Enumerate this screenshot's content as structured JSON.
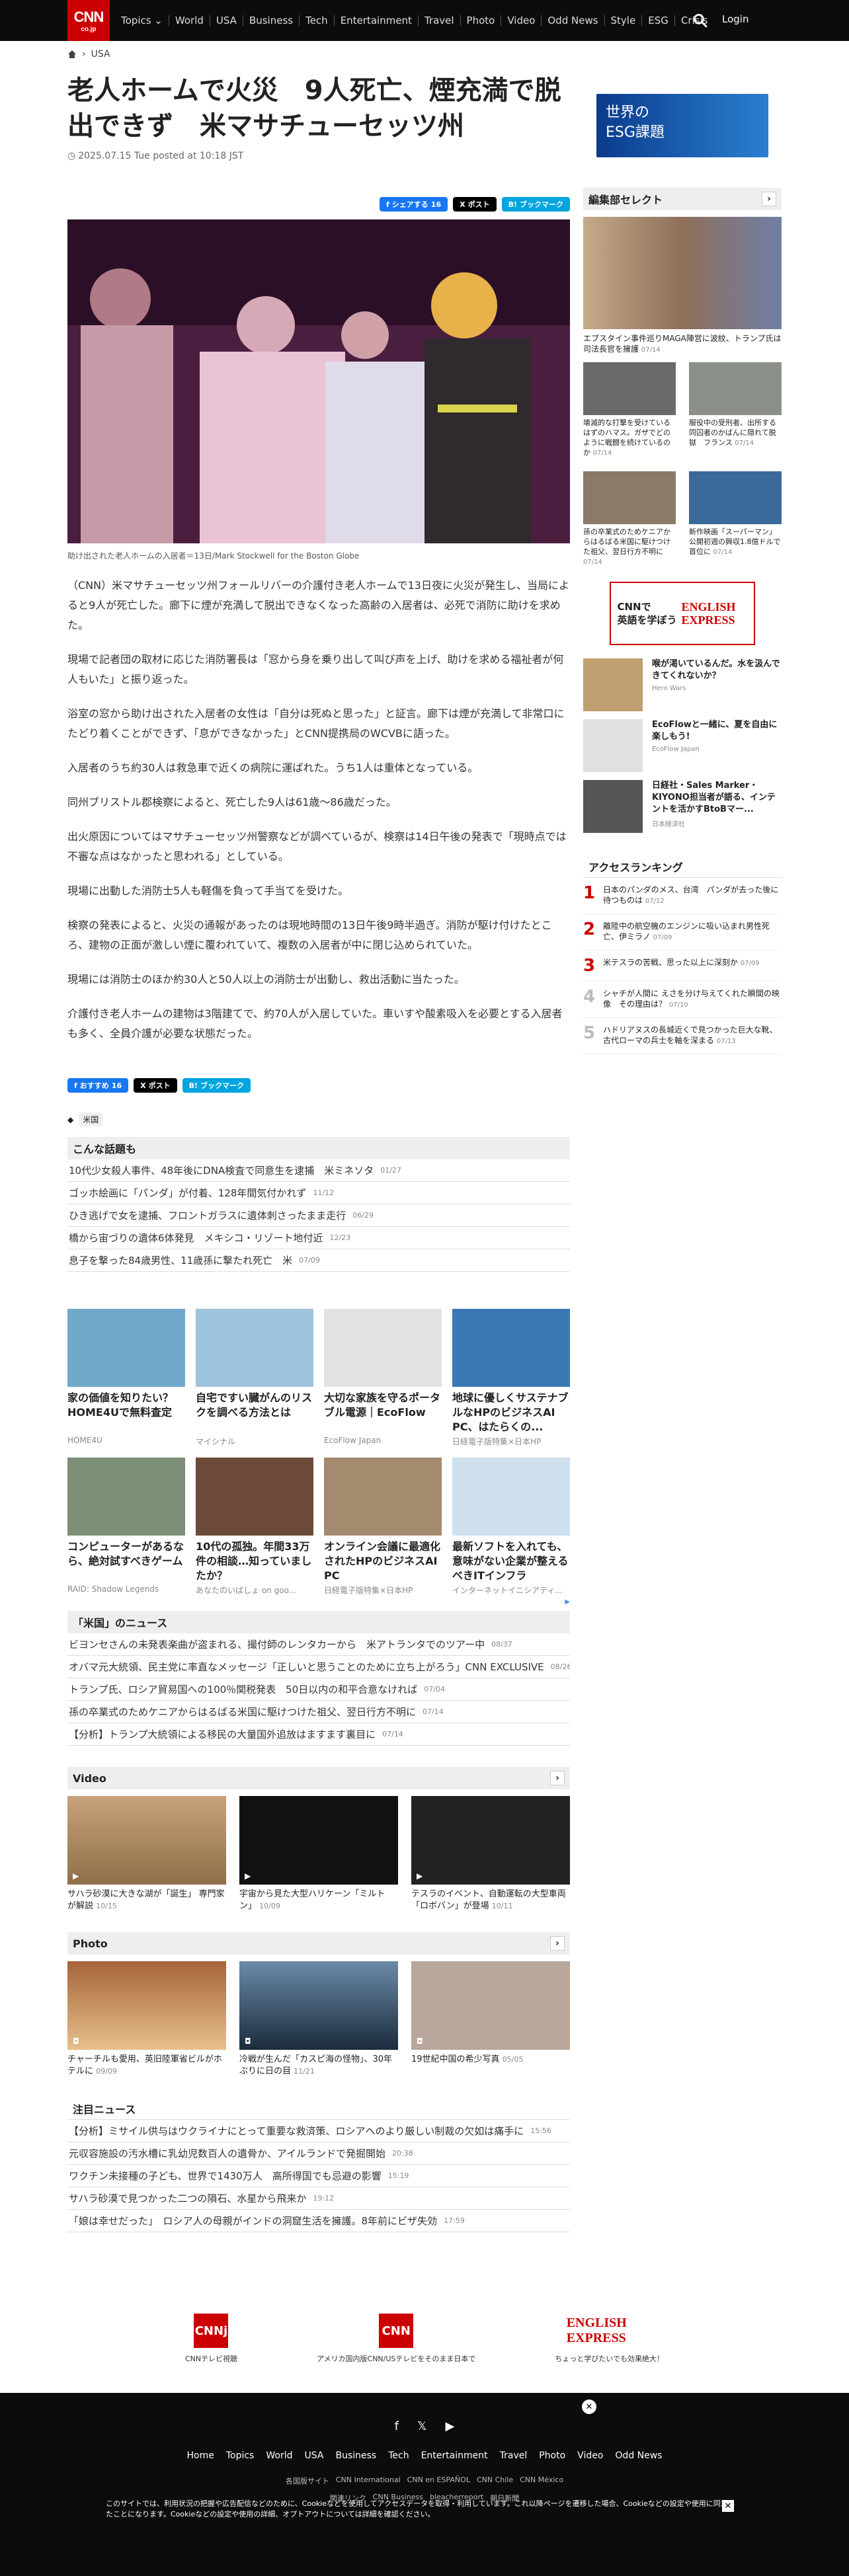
{
  "header": {
    "logo": "CNN",
    "logo_sub": "co.jp",
    "login": "Login",
    "nav": [
      "Topics",
      "World",
      "USA",
      "Business",
      "Tech",
      "Entertainment",
      "Travel",
      "Photo",
      "Video",
      "Odd News",
      "Style",
      "ESG",
      "Crisis"
    ]
  },
  "breadcrumb": {
    "home_icon": "home-icon",
    "section": "USA"
  },
  "article": {
    "title": "老人ホームで火災　9人死亡、煙充満で脱出できず　米マサチューセッツ州",
    "date": "2025.07.15 Tue posted at 10:18 JST",
    "share": {
      "fb": "シェアする",
      "fb_count": "16",
      "x": "ポスト",
      "hb": "ブックマーク",
      "fb2": "おすすめ",
      "fb2_count": "16"
    },
    "caption": "助け出された老人ホームの入居者＝13日/Mark Stockwell for the Boston Globe",
    "paragraphs": [
      "（CNN）米マサチューセッツ州フォールリバーの介護付き老人ホームで13日夜に火災が発生し、当局によると9人が死亡した。廊下に煙が充満して脱出できなくなった高齢の入居者は、必死で消防に助けを求めた。",
      "現場で記者団の取材に応じた消防署長は「窓から身を乗り出して叫び声を上げ、助けを求める福祉者が何人もいた」と振り返った。",
      "浴室の窓から助け出された入居者の女性は「自分は死ぬと思った」と証言。廊下は煙が充満して非常口にたどり着くことができず、「息ができなかった」とCNN提携局のWCVBに語った。",
      "入居者のうち約30人は救急車で近くの病院に運ばれた。うち1人は重体となっている。",
      "同州ブリストル郡検察によると、死亡した9人は61歳～86歳だった。",
      "出火原因についてはマサチューセッツ州警察などが調べているが、検察は14日午後の発表で「現時点では不審な点はなかったと思われる」としている。",
      "現場に出動した消防士5人も軽傷を負って手当てを受けた。",
      "検察の発表によると、火災の通報があったのは現地時間の13日午後9時半過ぎ。消防が駆け付けたところ、建物の正面が激しい煙に覆われていて、複数の入居者が中に閉じ込められていた。",
      "現場には消防士のほか約30人と50人以上の消防士が出動し、救出活動に当たった。",
      "介護付き老人ホームの建物は3階建てで、約70人が入居していた。車いすや酸素吸入を必要とする入居者も多く、全員介護が必要な状態だった。"
    ],
    "tag": "米国"
  },
  "related": {
    "title": "こんな話題も",
    "items": [
      {
        "t": "10代少女殺人事件、48年後にDNA検査で同意生を逮捕　米ミネソタ",
        "d": "01/27"
      },
      {
        "t": "ゴッホ絵画に「パンダ」が付着、128年間気付かれず",
        "d": "11/12"
      },
      {
        "t": "ひき逃げで女を逮捕、フロントガラスに遺体刺さったまま走行",
        "d": "06/29"
      },
      {
        "t": "橋から宙づりの遺体6体発見　メキシコ・リゾート地付近",
        "d": "12/23"
      },
      {
        "t": "息子を撃った84歳男性、11歳孫に撃たれ死亡　米",
        "d": "07/09"
      }
    ]
  },
  "promo": [
    {
      "t": "家の価値を知りたい？ HOME4Uで無料査定",
      "s": "HOME4U"
    },
    {
      "t": "自宅ですい臓がんのリスクを調べる方法とは",
      "s": "マイシナル"
    },
    {
      "t": "大切な家族を守るポータブル電源｜EcoFlow",
      "s": "EcoFlow Japan"
    },
    {
      "t": "地球に優しくサステナブルなHPのビジネスAI PC、はたらくの...",
      "s": "日経電子版特集×日本HP"
    },
    {
      "t": "コンピューターがあるなら、絶対試すべきゲーム",
      "s": "RAID: Shadow Legends"
    },
    {
      "t": "10代の孤独。年間33万件の相談…知っていましたか？",
      "s": "あなたのいばしょ on goo..."
    },
    {
      "t": "オンライン会議に最適化されたHPのビジネスAI PC",
      "s": "日経電子版特集×日本HP"
    },
    {
      "t": "最新ソフトを入れても、意味がない企業が整えるべきITインフラ",
      "s": "インターネットイニシアティ..."
    }
  ],
  "usnews": {
    "title": "「米国」のニュース",
    "items": [
      {
        "t": "ビヨンセさんの未発表楽曲が盗まれる、撮付師のレンタカーから　米アトランタでのツアー中",
        "d": "08/37"
      },
      {
        "t": "オバマ元大統領、民主党に率直なメッセージ「正しいと思うことのために立ち上がろう」CNN EXCLUSIVE",
        "d": "08/26"
      },
      {
        "t": "トランプ氏、ロシア貿易国への100％関税発表　50日以内の和平合意なければ",
        "d": "07/04"
      },
      {
        "t": "孫の卒業式のためケニアからはるばる米国に駆けつけた祖父、翌日行方不明に",
        "d": "07/14"
      },
      {
        "t": "【分析】トランプ大統領による移民の大量国外追放はますます裏目に",
        "d": "07/14"
      }
    ]
  },
  "video": {
    "title": "Video",
    "items": [
      {
        "t": "サハラ砂漠に大きな湖が「誕生」 専門家が解説",
        "d": "10/15"
      },
      {
        "t": "宇宙から見た大型ハリケーン「ミルトン」",
        "d": "10/09"
      },
      {
        "t": "テスラのイベント、自動運転の大型車両「ロボバン」が登場",
        "d": "10/11"
      }
    ]
  },
  "photo": {
    "title": "Photo",
    "items": [
      {
        "t": "チャーチルも愛用、英旧陸軍省ビルがホテルに",
        "d": "09/09"
      },
      {
        "t": "冷戦が生んだ「カスピ海の怪物」、30年ぶりに日の目",
        "d": "11/21"
      },
      {
        "t": "19世紀中国の希少写真",
        "d": "05/05"
      }
    ]
  },
  "featured": {
    "title": "注目ニュース",
    "items": [
      {
        "t": "【分析】ミサイル供与はウクライナにとって重要な救済策、ロシアへのより厳しい制裁の欠如は痛手に",
        "d": "15:56"
      },
      {
        "t": "元収容施設の汚水槽に乳幼児数百人の遺骨か、アイルランドで発掘開始",
        "d": "20:38"
      },
      {
        "t": "ワクチン未接種の子ども、世界で1430万人　高所得国でも忌避の影響",
        "d": "15:19"
      },
      {
        "t": "サハラ砂漠で見つかった二つの隕石、水星から飛来か",
        "d": "19:12"
      },
      {
        "t": "「娘は幸せだった」　ロシア人の母親がインドの洞窟生活を擁護。8年前にビザ失効",
        "d": "17:59"
      }
    ]
  },
  "sidebar": {
    "esg": "世界の\nESG課題",
    "editor_title": "編集部セレクト",
    "editor_main": {
      "t": "エプスタイン事件巡りMAGA陣営に波紋、トランプ氏は司法長官を擁護",
      "d": "07/14"
    },
    "editor_items": [
      {
        "t": "壊滅的な打撃を受けているはずのハマス。ガザでどのように戦闘を続けているのか",
        "d": "07/14"
      },
      {
        "t": "服役中の受刑者、出所する同囚者のかばんに隠れて脱獄　フランス",
        "d": "07/14"
      },
      {
        "t": "孫の卒業式のためケニアからはるばる米国に駆けつけた祖父、翌日行方不明に",
        "d": "07/14"
      },
      {
        "t": "新作映画「スーパーマン」公開初週の興収1.8億ドルで首位に",
        "d": "07/14"
      }
    ],
    "ad": {
      "left": "CNNで\n英語を学ぼう",
      "right": "ENGLISH EXPRESS"
    },
    "promo": [
      {
        "t": "喉が渇いているんだ。水を汲んできてくれないか？",
        "s": "Hero Wars"
      },
      {
        "t": "EcoFlowと一緒に、夏を自由に楽しもう!",
        "s": "EcoFlow Japan"
      },
      {
        "t": "日経社・Sales Marker・KIYONO担当者が語る、インテントを活かすBtoBマー...",
        "s": "日本経済社"
      }
    ],
    "rank_title": "アクセスランキング",
    "rank": [
      {
        "n": "1",
        "t": "日本のパンダのメス、台湾　パンダが去った後に待つものは",
        "d": "07/12"
      },
      {
        "n": "2",
        "t": "離陸中の航空機のエンジンに吸い込まれ男性死亡、伊ミラノ",
        "d": "07/09"
      },
      {
        "n": "3",
        "t": "米テスラの苦戦、思った以上に深刻か",
        "d": "07/09"
      },
      {
        "n": "4",
        "t": "シャチが人間に えさを分け与えてくれた瞬間の映像　その理由は？",
        "d": "07/10"
      },
      {
        "n": "5",
        "t": "ハドリアヌスの長城近くで見つかった巨大な靴、古代ローマの兵士を軸を深まる",
        "d": "07/13"
      }
    ]
  },
  "footer": {
    "logos": [
      {
        "b": "CNNj",
        "l": "CNNテレビ視聴"
      },
      {
        "b": "CNN",
        "l": "アメリカ国内版CNN/USテレビをそのまま日本で"
      },
      {
        "b": "ENGLISH EXPRESS",
        "l": "ちょっと学びたいでも効果絶大！"
      }
    ],
    "nav": [
      "Home",
      "Topics",
      "World",
      "USA",
      "Business",
      "Tech",
      "Entertainment",
      "Travel",
      "Photo",
      "Video",
      "Odd News"
    ],
    "sub": [
      "各国版サイト",
      "CNN International",
      "CNN en ESPAÑOL",
      "CNN Chile",
      "CNN México"
    ],
    "sub2": [
      "関連リンク",
      "CNN Business",
      "bleacherreport",
      "朝日新聞"
    ],
    "cookie": "このサイトでは、利用状況の把握や広告配信などのために、Cookieなどを使用してアクセスデータを取得・利用しています。これ以降ページを遷移した場合、Cookieなどの設定や使用に同意したことになります。Cookieなどの設定や使用の詳細、オプトアウトについては詳細を確認ください。"
  }
}
